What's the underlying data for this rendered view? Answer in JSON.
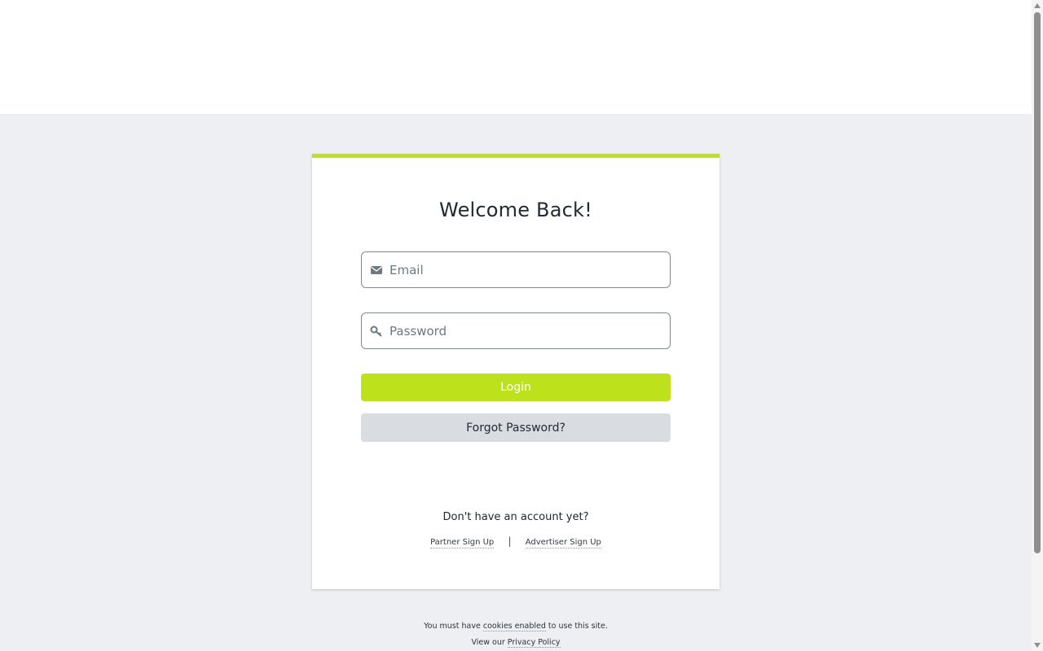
{
  "login_card": {
    "title": "Welcome Back!",
    "email": {
      "placeholder": "Email",
      "value": "",
      "icon": "envelope-icon"
    },
    "password": {
      "placeholder": "Password",
      "value": "",
      "icon": "key-icon"
    },
    "login_button": "Login",
    "forgot_button": "Forgot Password?",
    "no_account_text": "Don't have an account yet?",
    "signup_links": {
      "partner": "Partner Sign Up",
      "separator": "|",
      "advertiser": "Advertiser Sign Up"
    }
  },
  "footer": {
    "cookies_prefix": "You must have",
    "cookies_link": "cookies enabled",
    "cookies_suffix": "to use this site.",
    "privacy_prefix": "View our",
    "privacy_link": "Privacy Policy"
  },
  "colors": {
    "accent": "#bde21c",
    "background": "#edeff2",
    "secondary_button": "#d9dde1"
  }
}
